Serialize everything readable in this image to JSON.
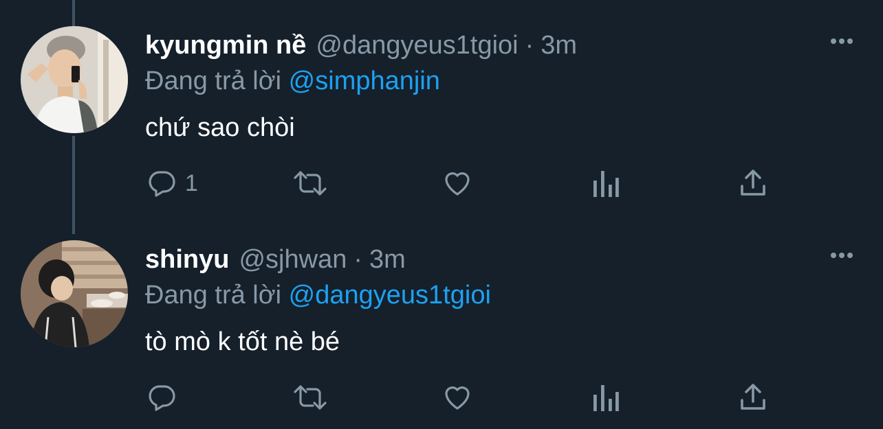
{
  "tweets": [
    {
      "display_name": "kyungmin nề",
      "handle": "@dangyeus1tgioi",
      "separator": "·",
      "time": "3m",
      "reply_prefix": "Đang trả lời",
      "reply_to": "@simphanjin",
      "text": "chứ sao chòi",
      "actions": {
        "reply_count": "1",
        "retweet_count": "",
        "like_count": ""
      }
    },
    {
      "display_name": "shinyu",
      "handle": "@sjhwan",
      "separator": "·",
      "time": "3m",
      "reply_prefix": "Đang trả lời",
      "reply_to": "@dangyeus1tgioi",
      "text": "tò mò k tốt nè bé",
      "actions": {
        "reply_count": "",
        "retweet_count": "",
        "like_count": ""
      }
    }
  ],
  "icons": {
    "reply": "reply-icon",
    "retweet": "retweet-icon",
    "like": "heart-icon",
    "analytics": "analytics-icon",
    "share": "share-icon",
    "more": "more-icon"
  },
  "colors": {
    "background": "#15202b",
    "primary_text": "#ffffff",
    "secondary_text": "#8899a6",
    "mention": "#1da1f2",
    "thread_line": "#3d5466"
  }
}
